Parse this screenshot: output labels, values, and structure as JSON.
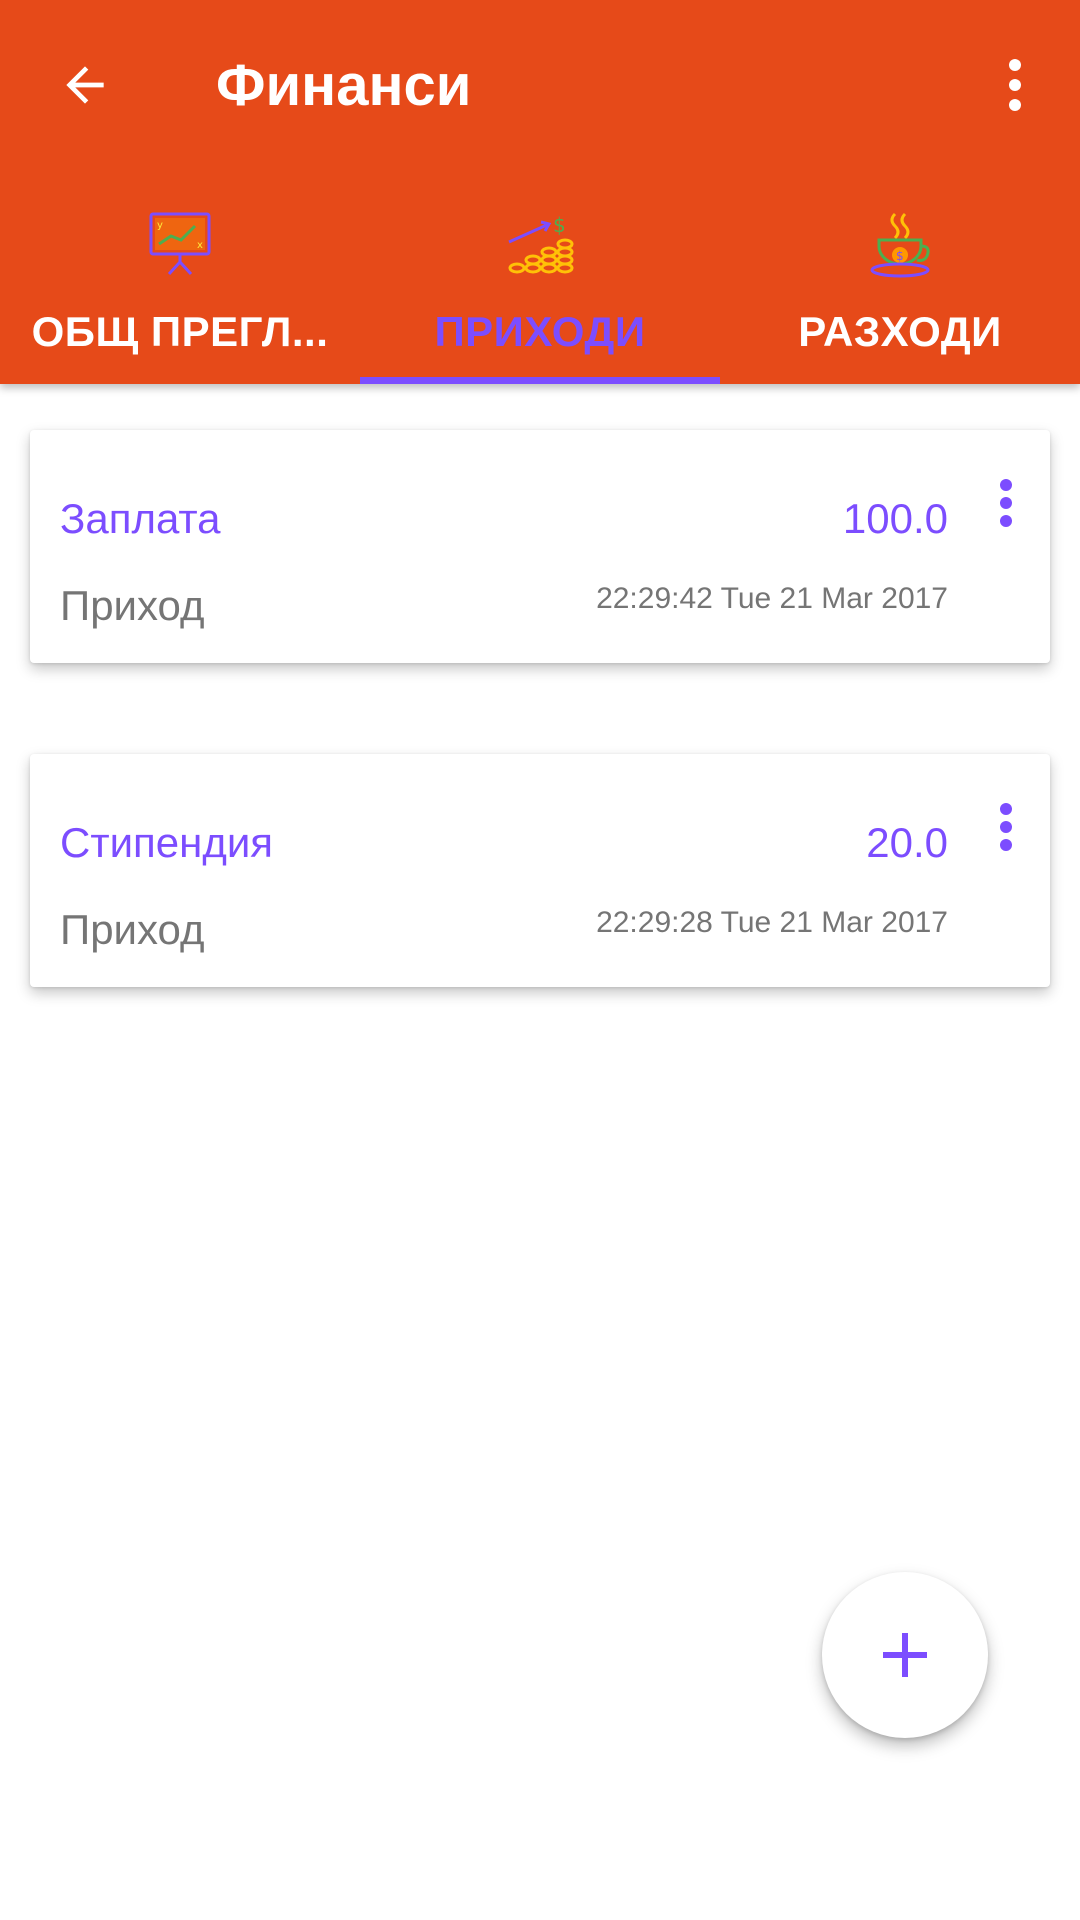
{
  "toolbar": {
    "title": "Финанси",
    "back_icon": "arrow-back-icon",
    "overflow_icon": "more-vert-icon"
  },
  "tabs": [
    {
      "label": "ОБЩ ПРЕГЛ...",
      "icon": "chart-board-icon",
      "active": false
    },
    {
      "label": "ПРИХОДИ",
      "icon": "rising-coins-icon",
      "active": true
    },
    {
      "label": "РАЗХОДИ",
      "icon": "money-cup-icon",
      "active": false
    }
  ],
  "entries": [
    {
      "name": "Заплата",
      "amount": "100.0",
      "type": "Приход",
      "date": "22:29:42 Tue 21 Mar 2017"
    },
    {
      "name": "Стипендия",
      "amount": "20.0",
      "type": "Приход",
      "date": "22:29:28 Tue 21 Mar 2017"
    }
  ],
  "fab": {
    "icon": "add-icon"
  },
  "colors": {
    "primary": "#E64A19",
    "accent": "#7C4DFF",
    "secondary_text": "#757575",
    "white": "#FFFFFF"
  }
}
